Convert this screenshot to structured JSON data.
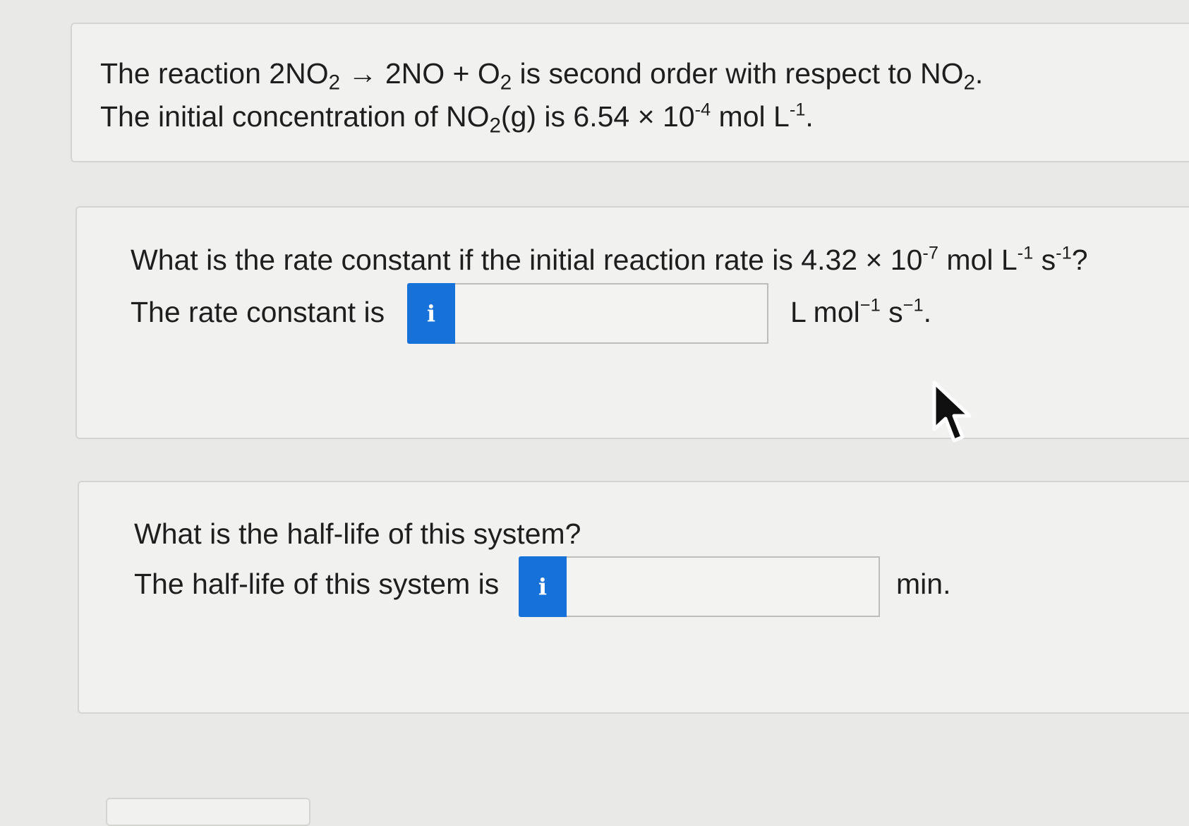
{
  "intro": {
    "line1": {
      "t1": "The reaction 2NO",
      "s1": "2",
      "t2": " → 2NO + O",
      "s2": "2",
      "t3": " is second order with respect to NO",
      "s3": "2",
      "t4": "."
    },
    "line2": {
      "t1": "The initial concentration of NO",
      "s1": "2",
      "t2": "(g) is 6.54 × 10",
      "sup1": "-4",
      "t3": " mol L",
      "sup2": "-1",
      "t4": "."
    }
  },
  "question1": {
    "question": {
      "t1": "What is the rate constant if the initial reaction rate is 4.32 × 10",
      "sup1": "-7",
      "t2": " mol L",
      "sup2": "-1",
      "t3": " s",
      "sup3": "-1",
      "t4": "?"
    },
    "prompt": "The rate constant is",
    "info_icon": "i",
    "input_value": "",
    "unit": {
      "t1": "L mol",
      "sup1": "−1",
      "t2": " s",
      "sup2": "−1",
      "t3": "."
    }
  },
  "question2": {
    "question": "What is the half-life of this system?",
    "prompt": "The half-life of this system is",
    "info_icon": "i",
    "input_value": "",
    "unit": "min."
  },
  "colors": {
    "accent": "#1671d9",
    "panel": "#f1f1ef",
    "background": "#e9e9e7"
  },
  "icons": {
    "info": "info-icon",
    "cursor": "mouse-pointer-icon"
  }
}
